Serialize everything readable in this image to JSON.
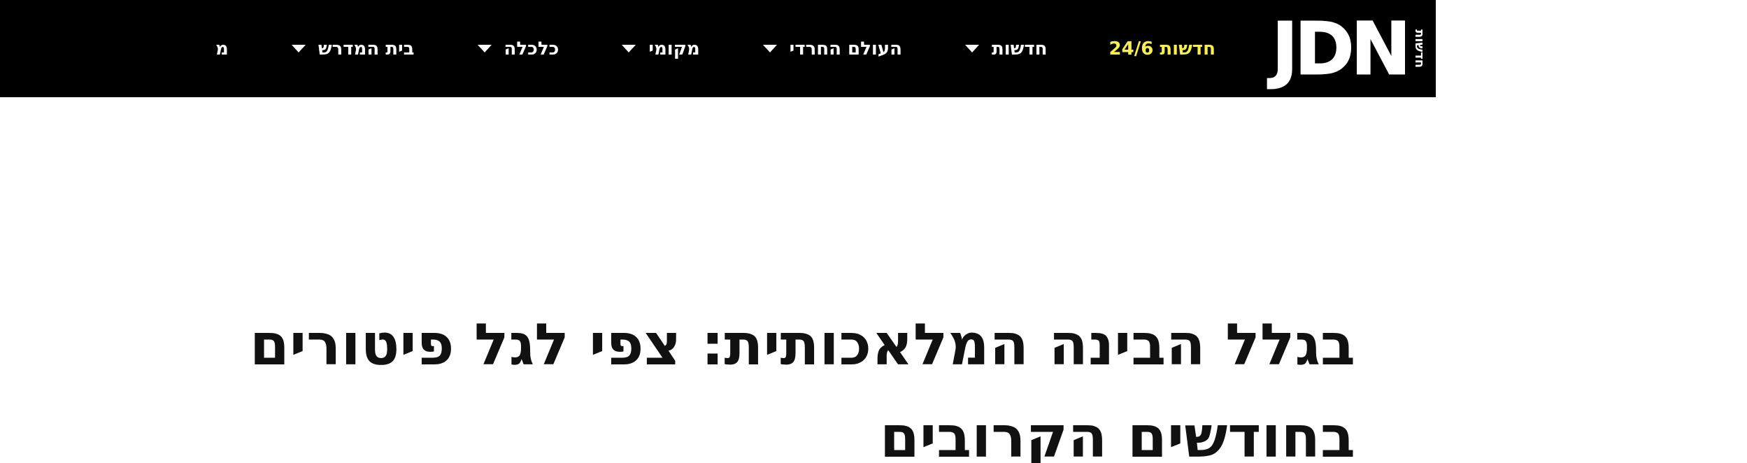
{
  "header": {
    "logo": {
      "letters": "JDN",
      "side_text": "חדשות"
    },
    "highlight_link": "חדשות 24/6",
    "nav_items": [
      {
        "label": "חדשות"
      },
      {
        "label": "העולם החרדי"
      },
      {
        "label": "מקומי"
      },
      {
        "label": "כלכלה"
      },
      {
        "label": "בית המדרש"
      },
      {
        "label": "מ"
      }
    ],
    "colors": {
      "background": "#000000",
      "highlight": "#f7ef4c",
      "text": "#ffffff"
    }
  },
  "article": {
    "title": "בגלל הבינה המלאכותית: צפי לגל פיטורים בחודשים הקרובים"
  }
}
